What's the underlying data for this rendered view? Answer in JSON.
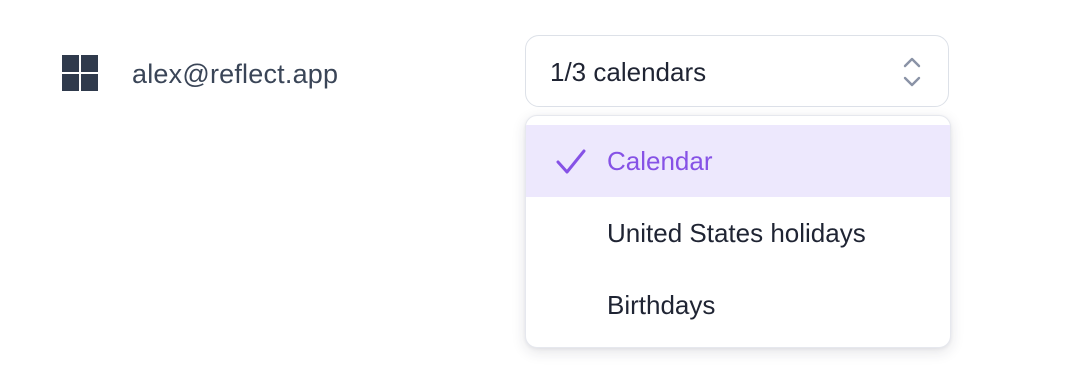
{
  "account": {
    "provider_icon": "microsoft-icon",
    "email": "alex@reflect.app"
  },
  "calendar_select": {
    "value": "1/3 calendars",
    "icon": "chevron-up-down-icon"
  },
  "calendar_menu": {
    "items": [
      {
        "label": "Calendar",
        "checked": true
      },
      {
        "label": "United States holidays",
        "checked": false
      },
      {
        "label": "Birthdays",
        "checked": false
      }
    ],
    "check_icon": "checkmark-icon"
  },
  "colors": {
    "accent": "#8652e6",
    "selected_bg": "#ede8fd",
    "text": "#1f2433",
    "icon": "#2f3a4c"
  }
}
